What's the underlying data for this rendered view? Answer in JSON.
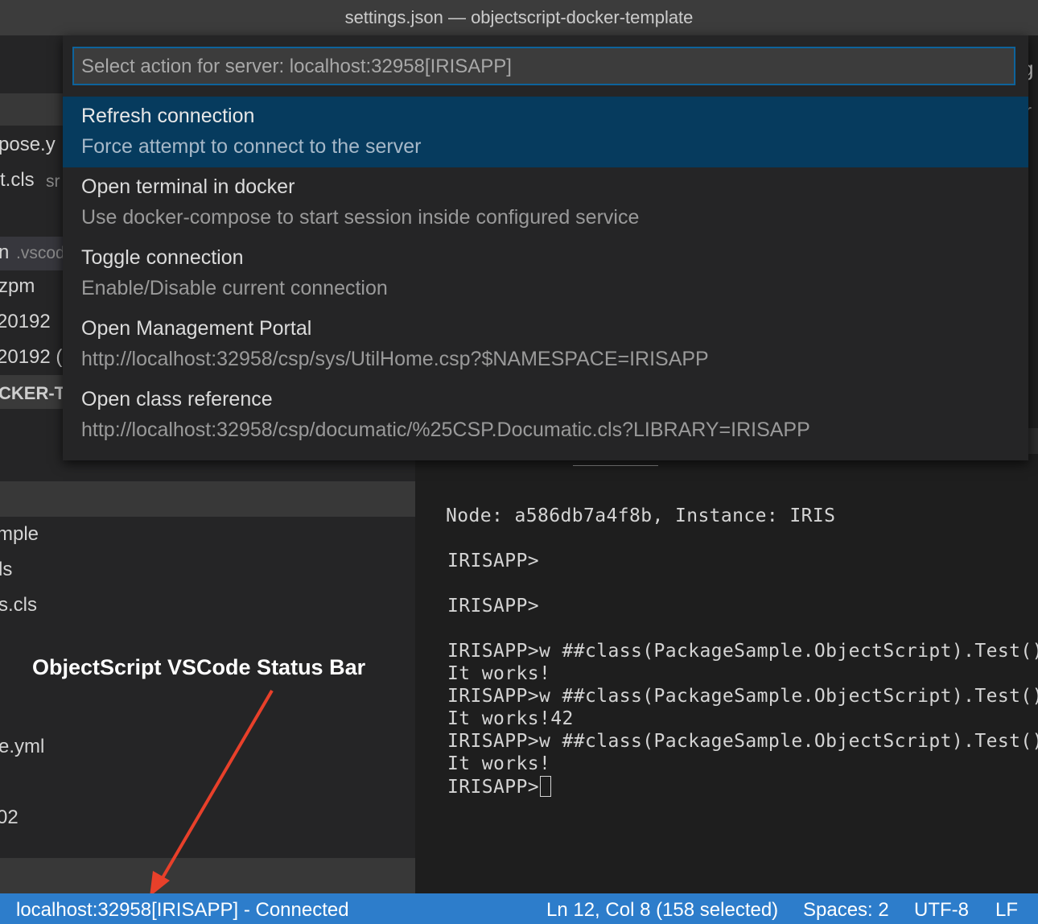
{
  "window": {
    "title": "settings.json — objectscript-docker-template"
  },
  "quickpick": {
    "placeholder": "Select action for server: localhost:32958[IRISAPP]",
    "items": [
      {
        "label": "Refresh connection",
        "detail": "Force attempt to connect to the server",
        "selected": true
      },
      {
        "label": "Open terminal in docker",
        "detail": "Use docker-compose to start session inside configured service"
      },
      {
        "label": "Toggle connection",
        "detail": "Enable/Disable current connection"
      },
      {
        "label": "Open Management Portal",
        "detail": "http://localhost:32958/csp/sys/UtilHome.csp?$NAMESPACE=IRISAPP"
      },
      {
        "label": "Open class reference",
        "detail": "http://localhost:32958/csp/documatic/%25CSP.Documatic.cls?LIBRARY=IRISAPP"
      }
    ]
  },
  "sidebar": {
    "fragments": {
      "f1": "pose.y",
      "f2": "t.cls",
      "f2b": "sr",
      "f3": "n",
      "f3b": ".vscod",
      "f4": "zpm",
      "f5": "20192",
      "f6": "20192 (",
      "f7": "CKER-T",
      "f8": "mple",
      "f9": "ls",
      "f10": "s.cls",
      "f11": "e.yml",
      "f12": "02"
    }
  },
  "editor": {
    "edge_fragment": "g",
    "edge_fragment2": "r"
  },
  "terminal": {
    "lines": [
      "Node: a586db7a4f8b, Instance: IRIS",
      "IRISAPP>",
      "IRISAPP>",
      "IRISAPP>w ##class(PackageSample.ObjectScript).Test()",
      "It works!",
      "IRISAPP>w ##class(PackageSample.ObjectScript).Test()",
      "It works!42",
      "IRISAPP>w ##class(PackageSample.ObjectScript).Test()",
      "It works!",
      "IRISAPP>"
    ]
  },
  "annotation": {
    "text": "ObjectScript VSCode Status Bar",
    "arrow_color": "#e8402a"
  },
  "statusbar": {
    "connection": "localhost:32958[IRISAPP] - Connected",
    "position": "Ln 12, Col 8 (158 selected)",
    "spaces": "Spaces: 2",
    "encoding": "UTF-8",
    "eol": "LF"
  },
  "colors": {
    "statusbar_bg": "#2d7dcb",
    "quickpick_selected": "#063b5e",
    "input_border": "#0e639c"
  }
}
